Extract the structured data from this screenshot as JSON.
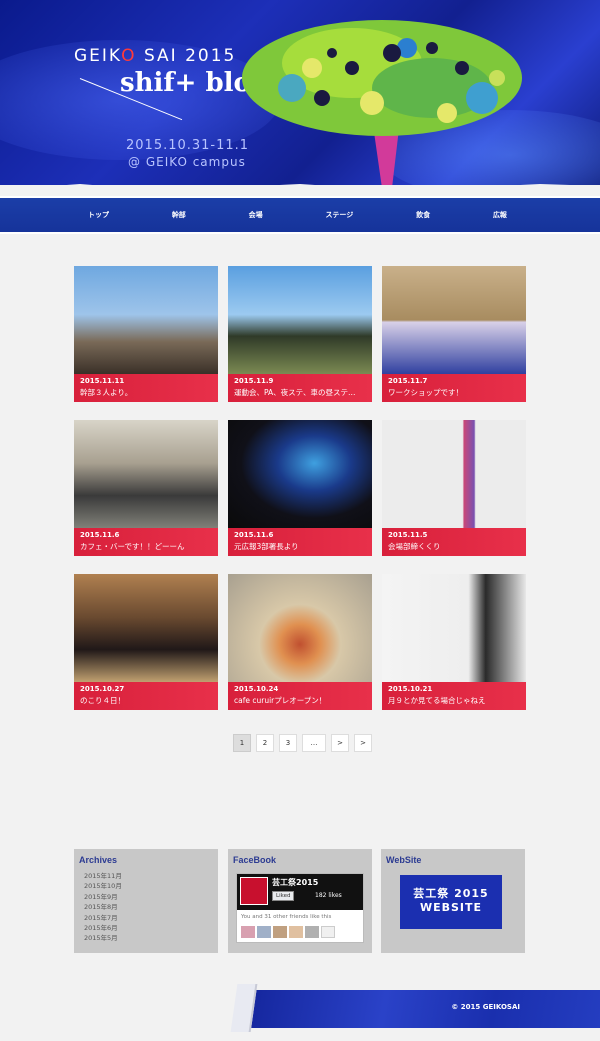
{
  "header": {
    "event_name_prefix": "GEIK",
    "event_name_o": "O",
    "event_name_suffix": " SAI 2015",
    "blog_title": "shif+ blog",
    "dates": "2015.10.31-11.1",
    "venue": "@ GEIKO campus"
  },
  "nav": {
    "items": [
      "トップ",
      "幹部",
      "会場",
      "ステージ",
      "飲食",
      "広報"
    ]
  },
  "posts": [
    {
      "date": "2015.11.11",
      "title": "幹部３人より。"
    },
    {
      "date": "2015.11.9",
      "title": "運動会、PA、夜ステ、車の昼ステ…"
    },
    {
      "date": "2015.11.7",
      "title": "ワークショップです！"
    },
    {
      "date": "2015.11.6",
      "title": "カフェ・バーです！！どーーん"
    },
    {
      "date": "2015.11.6",
      "title": "元広報3部署長より"
    },
    {
      "date": "2015.11.5",
      "title": "会場部締くくり"
    },
    {
      "date": "2015.10.27",
      "title": "のこり４日！"
    },
    {
      "date": "2015.10.24",
      "title": "cafe curuirプレオープン！"
    },
    {
      "date": "2015.10.21",
      "title": "月９とか見てる場合じゃねえ"
    }
  ],
  "pager": [
    "1",
    "2",
    "3",
    "…",
    ">",
    ">"
  ],
  "archives": {
    "title": "Archives",
    "items": [
      "2015年11月",
      "2015年10月",
      "2015年9月",
      "2015年8月",
      "2015年7月",
      "2015年6月",
      "2015年5月"
    ]
  },
  "facebook": {
    "title": "FaceBook",
    "page_name": "芸工祭2015",
    "like_label": "Liked",
    "likes": "182 likes",
    "friends_text": "You and 31 other friends like this"
  },
  "website": {
    "title": "WebSite",
    "line1": "芸工祭 2015",
    "line2": "WEBSITE"
  },
  "footer": {
    "copyright": "© 2015 GEIKOSAI"
  }
}
